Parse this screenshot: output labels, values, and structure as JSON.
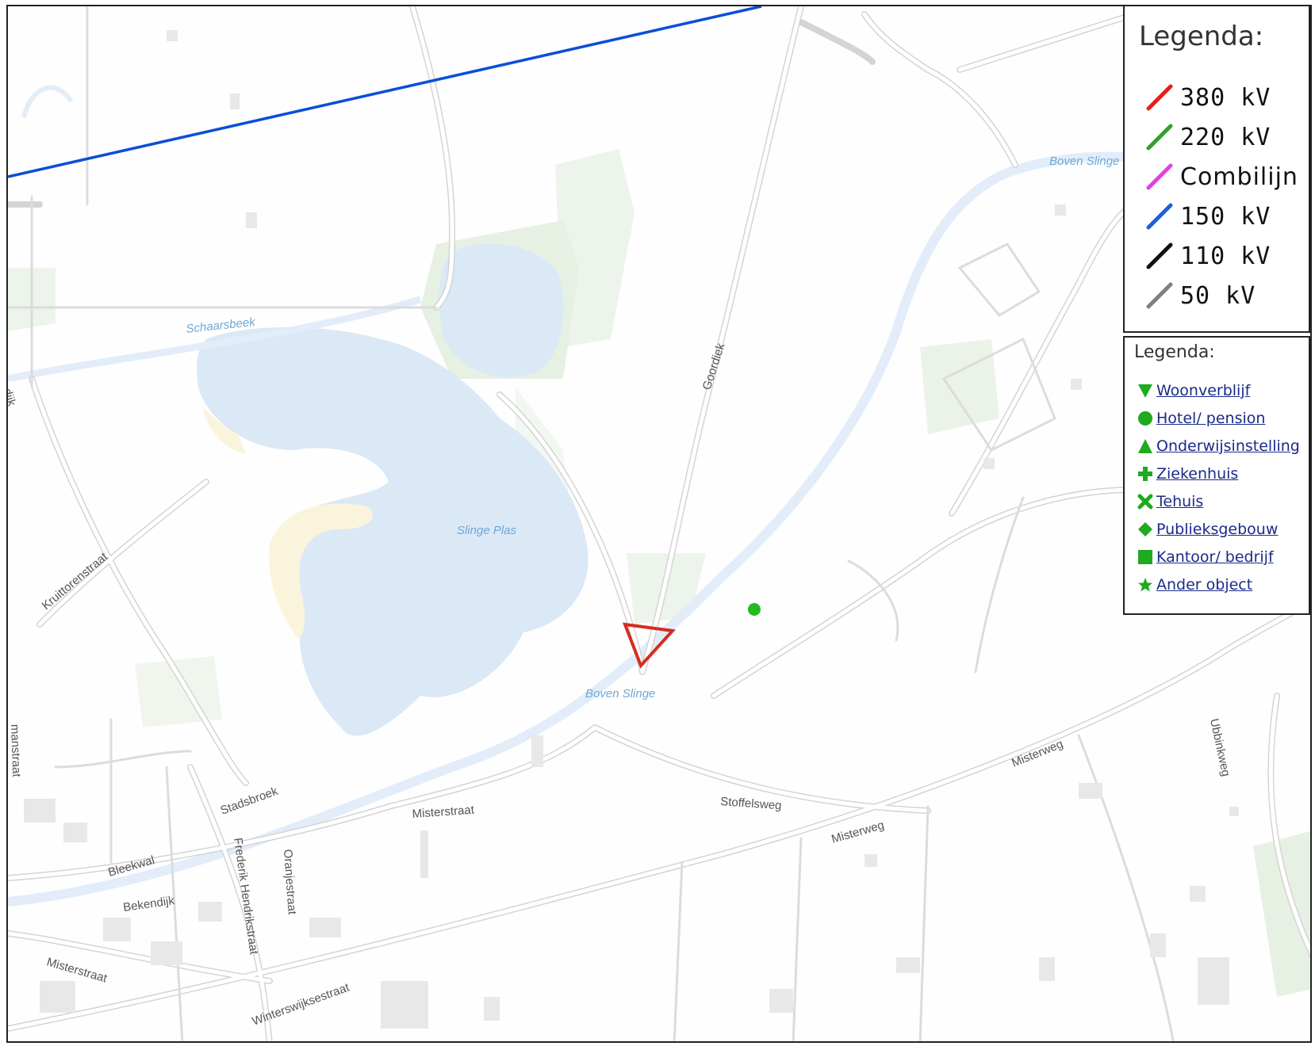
{
  "map": {
    "street_labels": {
      "schaarsbeek": "Schaarsbeek",
      "slinge_plas": "Slinge Plas",
      "boven_slinge_top": "Boven Slinge",
      "boven_slinge_bottom": "Boven Slinge",
      "goordiek": "Goordiek",
      "kruittorenstraat": "Kruittorenstraat",
      "stadsbroek": "Stadsbroek",
      "misterstraat_mid": "Misterstraat",
      "stoffelsweg": "Stoffelsweg",
      "misterweg_right": "Misterweg",
      "misterweg_mid": "Misterweg",
      "ubbinkweg": "Ubbinkweg",
      "bleekwal": "Bleekwal",
      "bekendijk": "Bekendijk",
      "frederik_hendrikstraat": "Frederik Hendrikstraat",
      "oranjestraat": "Oranjestraat",
      "misterstraat_left": "Misterstraat",
      "winterswijksestraat": "Winterswijksestraat",
      "dijk_partial": "dijk",
      "straat_partial": "manstraat"
    },
    "colors": {
      "water": "#dde9f6",
      "road_casing": "#d8d8d8",
      "green": "#e3efe0",
      "powerline_150kv": "#0a4fd6",
      "marker_triangle": "#d62d20",
      "marker_hotel": "#22bb22"
    }
  },
  "legend_lines": {
    "title": "Legenda:",
    "items": [
      {
        "label": "380 kV",
        "color": "#e3201b",
        "icon": "line-swatch-red"
      },
      {
        "label": "220 kV",
        "color": "#33a02c",
        "icon": "line-swatch-green"
      },
      {
        "label": "Combilijn",
        "color": "#e040e8",
        "icon": "line-swatch-magenta"
      },
      {
        "label": "150 kV",
        "color": "#1f5fd8",
        "icon": "line-swatch-blue"
      },
      {
        "label": "110 kV",
        "color": "#111111",
        "icon": "line-swatch-black"
      },
      {
        "label": "50 kV",
        "color": "#808080",
        "icon": "line-swatch-gray"
      }
    ]
  },
  "legend_objects": {
    "title": "Legenda:",
    "items": [
      {
        "label": "Woonverblijf",
        "icon": "down-triangle-icon"
      },
      {
        "label": "Hotel/ pension",
        "icon": "circle-icon"
      },
      {
        "label": "Onderwijsinstelling",
        "icon": "up-triangle-icon"
      },
      {
        "label": "Ziekenhuis",
        "icon": "plus-icon"
      },
      {
        "label": "Tehuis",
        "icon": "cross-icon"
      },
      {
        "label": "Publieksgebouw",
        "icon": "diamond-icon"
      },
      {
        "label": "Kantoor/ bedrijf",
        "icon": "square-icon"
      },
      {
        "label": "Ander object",
        "icon": "star-icon"
      }
    ],
    "icon_color": "#1faa1f"
  }
}
